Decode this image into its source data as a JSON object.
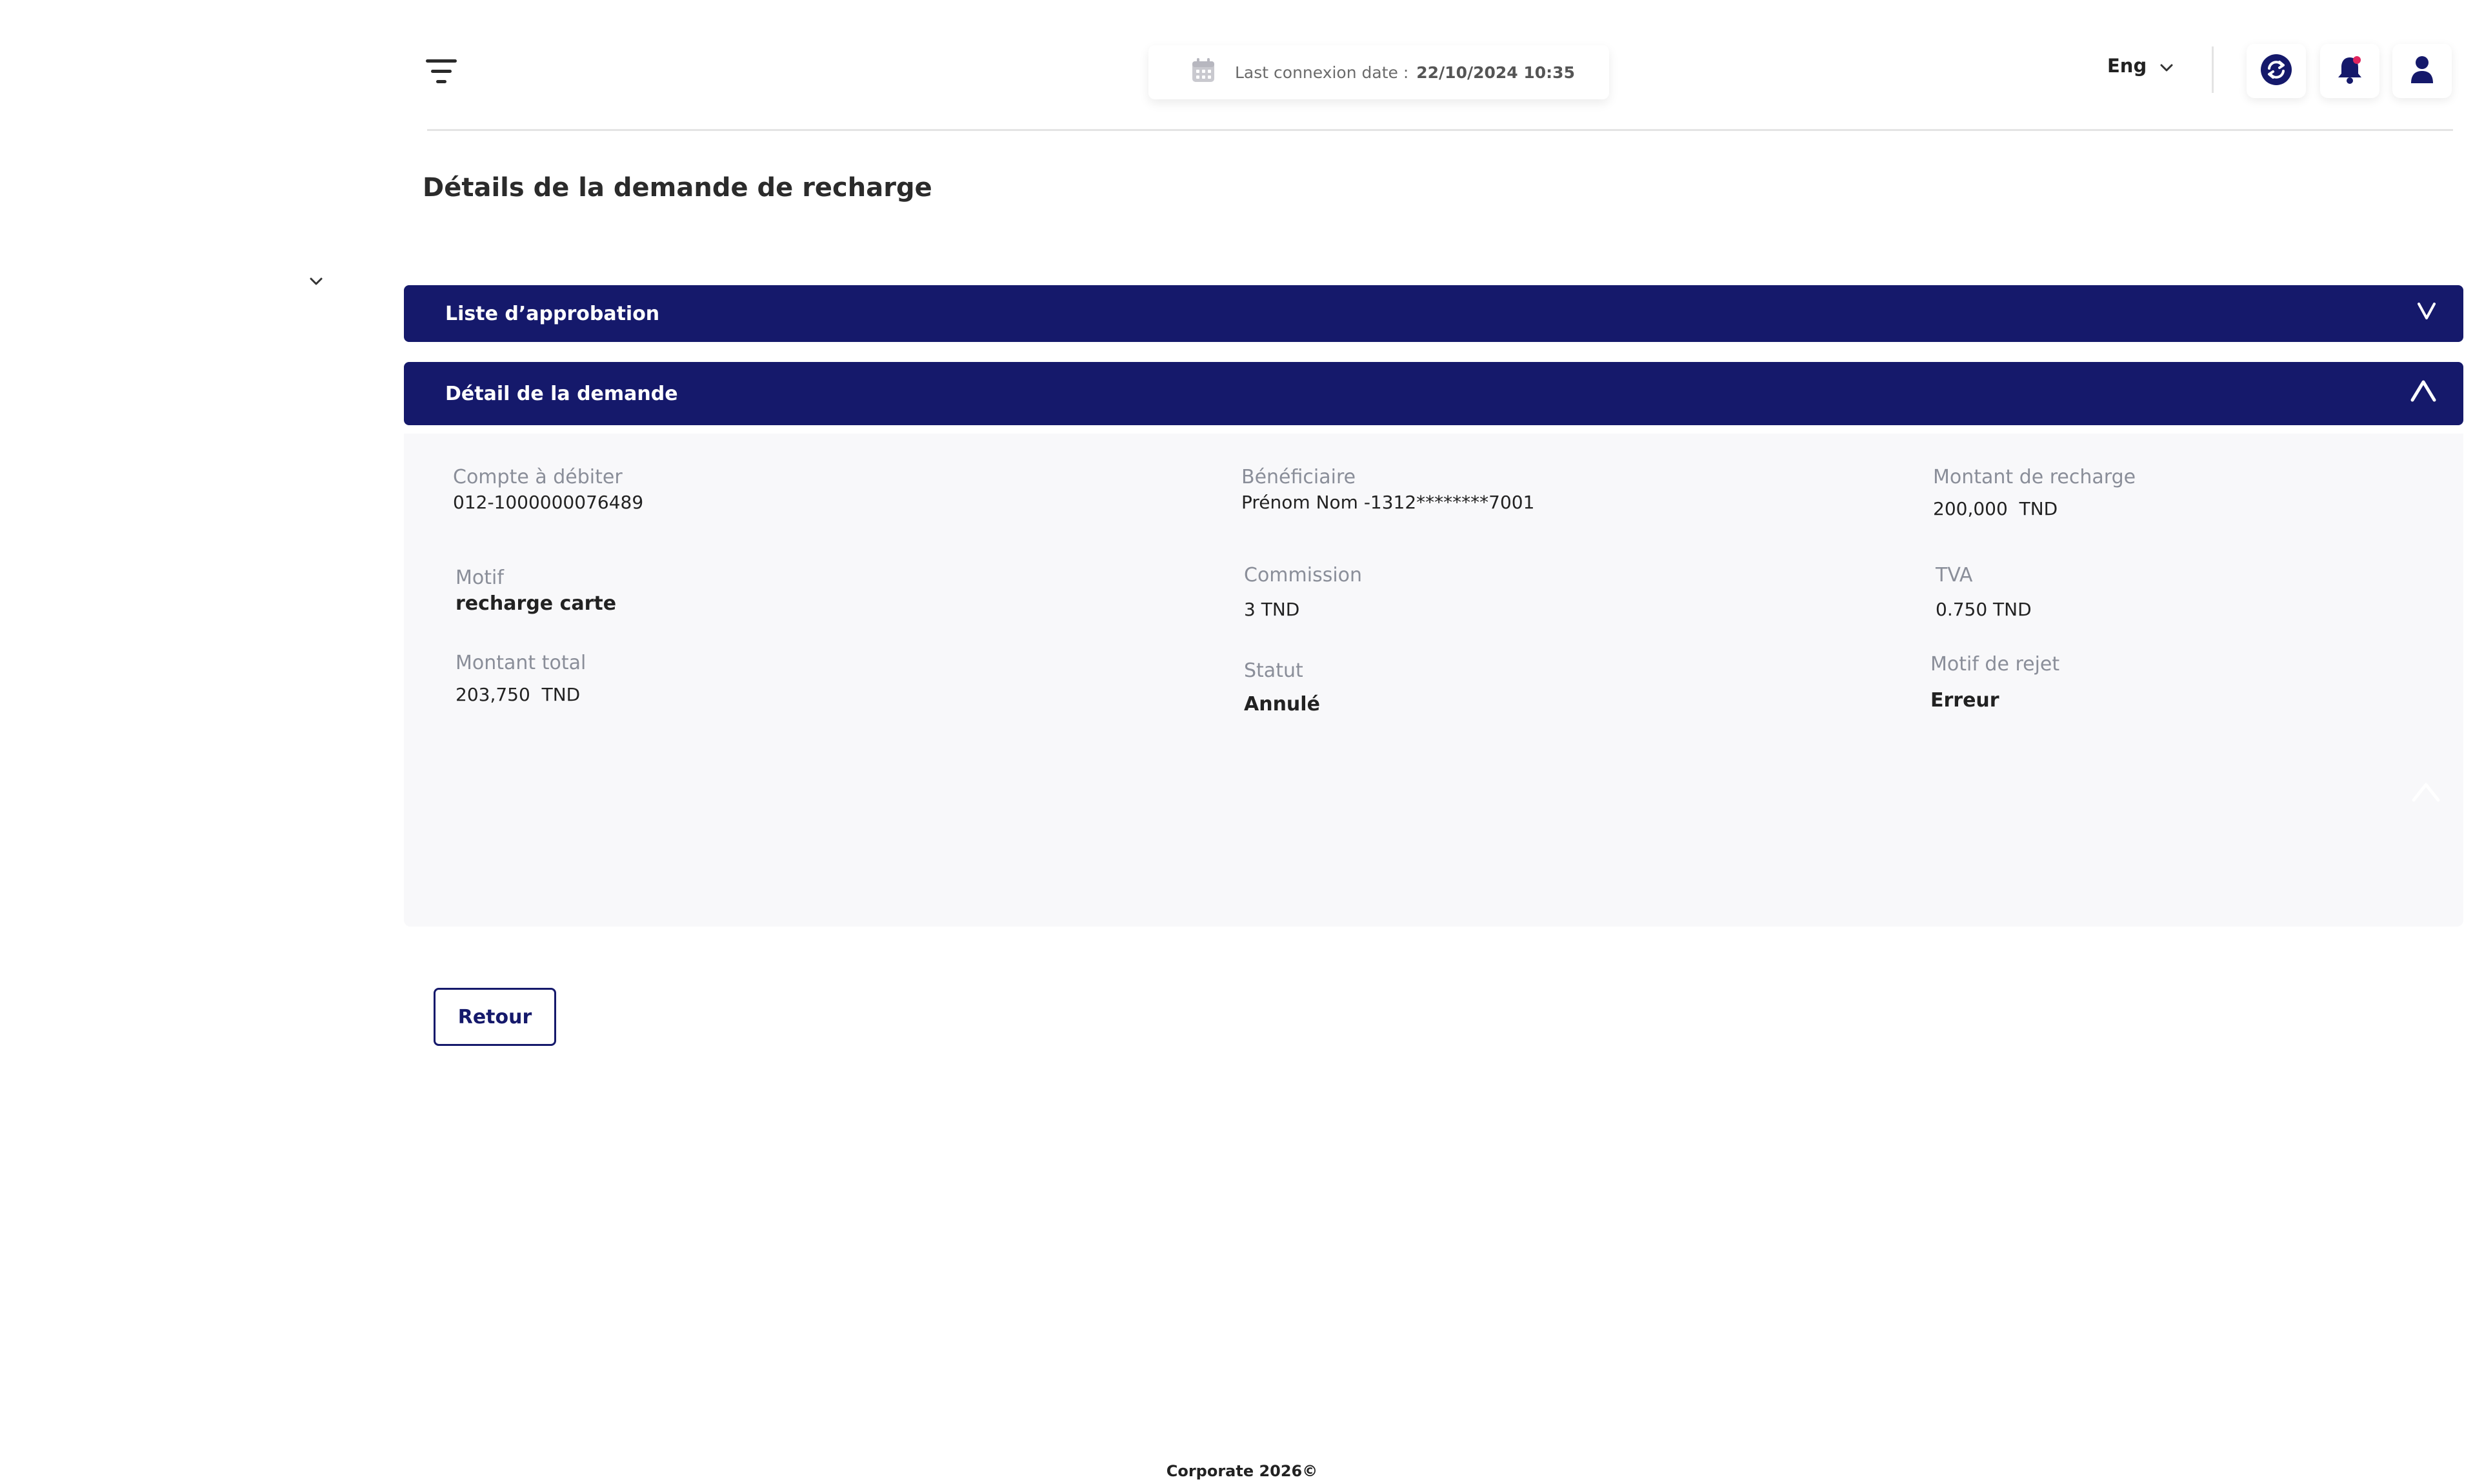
{
  "header": {
    "last_connexion_label": "Last connexion date :",
    "last_connexion_value": "22/10/2024 10:35",
    "language": "Eng",
    "icons": [
      "menu-icon",
      "calendar-icon",
      "chevron-down-icon",
      "switch-account-icon",
      "bell-icon",
      "user-icon"
    ]
  },
  "page_title": "Détails de la demande de recharge",
  "accordions": {
    "approval_title": "Liste d’approbation",
    "detail_title": "Détail de la demande"
  },
  "details": {
    "compte_label": "Compte à débiter",
    "compte_value": "012-1000000076489",
    "beneficiaire_label": "Bénéficiaire",
    "beneficiaire_value": "Prénom Nom -1312********7001",
    "montant_recharge_label": "Montant de recharge",
    "montant_recharge_value": "200,000",
    "montant_recharge_currency": "TND",
    "motif_label": "Motif",
    "motif_value": "recharge carte",
    "commission_label": "Commission",
    "commission_value": "3 TND",
    "tva_label": "TVA",
    "tva_value": "0.750 TND",
    "montant_total_label": "Montant total",
    "montant_total_value": "203,750",
    "montant_total_currency": "TND",
    "statut_label": "Statut",
    "statut_value": "Annulé",
    "motif_rejet_label": "Motif de rejet",
    "motif_rejet_value": "Erreur"
  },
  "actions": {
    "retour_label": "Retour"
  },
  "footer": {
    "text": "Corporate 2026©"
  },
  "colors": {
    "primary": "#15196b",
    "notification_dot": "#e0245e",
    "panel_bg": "#f8f8fa"
  }
}
